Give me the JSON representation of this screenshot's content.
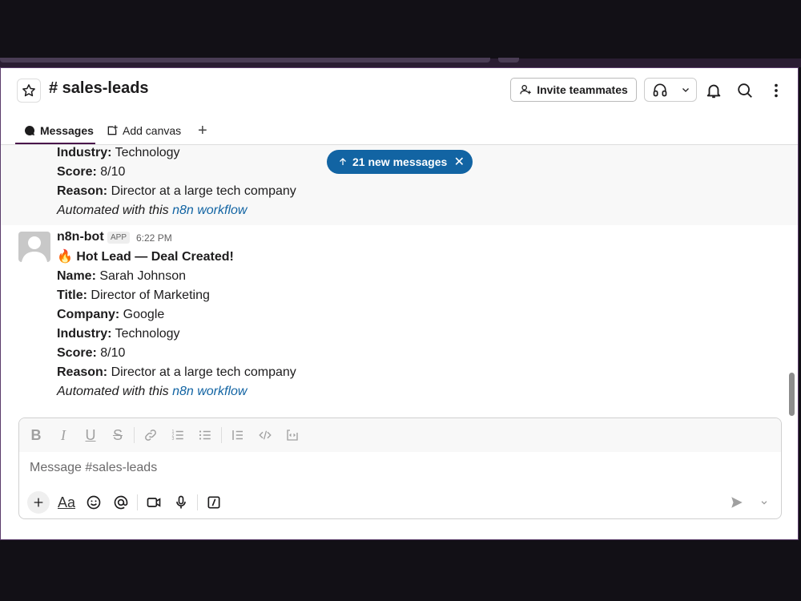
{
  "header": {
    "channel_name": "# sales-leads",
    "invite_label": "Invite teammates"
  },
  "tabs": [
    {
      "label": "Messages"
    },
    {
      "label": "Add canvas"
    }
  ],
  "previous_message": {
    "industry_label": "Industry:",
    "industry_value": " Technology",
    "score_label": "Score:",
    "score_value": " 8/10",
    "reason_label": "Reason:",
    "reason_value": " Director at a large tech company",
    "automated_text": "Automated with this ",
    "automated_link": "n8n workflow"
  },
  "message": {
    "sender": "n8n-bot",
    "badge": "APP",
    "time": "6:22 PM",
    "headline": "🔥 Hot Lead — Deal Created!",
    "name_label": "Name:",
    "name_value": " Sarah Johnson",
    "title_label": "Title:",
    "title_value": " Director of Marketing",
    "company_label": "Company:",
    "company_value": " Google",
    "industry_label": "Industry:",
    "industry_value": " Technology",
    "score_label": "Score:",
    "score_value": " 8/10",
    "reason_label": "Reason:",
    "reason_value": " Director at a large tech company",
    "automated_text": "Automated with this ",
    "automated_link": "n8n workflow"
  },
  "new_messages_pill": {
    "label": "21 new messages"
  },
  "composer": {
    "placeholder": "Message #sales-leads",
    "format_tools": [
      "bold-icon",
      "italic-icon",
      "underline-icon",
      "strikethrough-icon",
      "link-icon",
      "ordered-list-icon",
      "bulleted-list-icon",
      "blockquote-icon",
      "code-icon",
      "code-block-icon"
    ],
    "bottom_tools": [
      "plus-icon",
      "text-format-icon",
      "emoji-icon",
      "mention-icon",
      "video-icon",
      "microphone-icon",
      "slash-command-icon"
    ],
    "aa_label": "Aa"
  },
  "colors": {
    "accent": "#1264a3",
    "tab_underline": "#4a154b",
    "window_border": "#5b3d6b"
  }
}
